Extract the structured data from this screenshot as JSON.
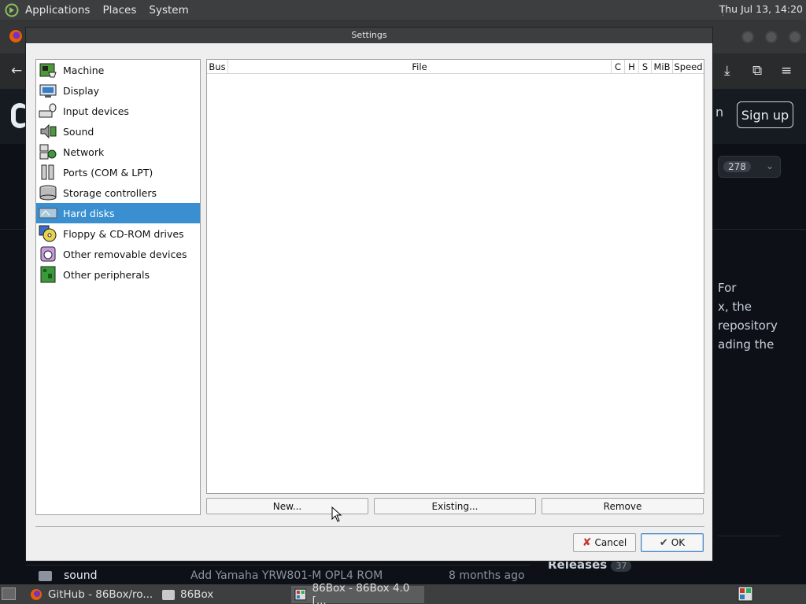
{
  "topbar": {
    "menus": [
      "Applications",
      "Places",
      "System"
    ],
    "clock": "Thu Jul 13, 14:20"
  },
  "background": {
    "signup": "Sign up",
    "in_partial": "n",
    "star_count": "278",
    "text_lines": [
      "For",
      "x, the",
      "repository",
      "ading the"
    ],
    "row_folder": "sound",
    "row_commit": "Add Yamaha YRW801-M OPL4 ROM",
    "row_time": "8 months ago",
    "releases_label": "Releases",
    "releases_count": "37"
  },
  "dialog": {
    "title": "Settings",
    "categories": [
      {
        "label": "Machine",
        "icon": "machine-icon"
      },
      {
        "label": "Display",
        "icon": "display-icon"
      },
      {
        "label": "Input devices",
        "icon": "input-devices-icon"
      },
      {
        "label": "Sound",
        "icon": "sound-icon"
      },
      {
        "label": "Network",
        "icon": "network-icon"
      },
      {
        "label": "Ports (COM & LPT)",
        "icon": "ports-icon"
      },
      {
        "label": "Storage controllers",
        "icon": "storage-icon"
      },
      {
        "label": "Hard disks",
        "icon": "hard-disk-icon",
        "selected": true
      },
      {
        "label": "Floppy & CD-ROM drives",
        "icon": "floppy-cdrom-icon"
      },
      {
        "label": "Other removable devices",
        "icon": "removable-devices-icon"
      },
      {
        "label": "Other peripherals",
        "icon": "peripherals-icon"
      }
    ],
    "columns": [
      "Bus",
      "File",
      "C",
      "H",
      "S",
      "MiB",
      "Speed"
    ],
    "buttons": {
      "new": "New...",
      "existing": "Existing...",
      "remove": "Remove"
    },
    "cancel": "Cancel",
    "ok": "OK"
  },
  "taskbar": {
    "tasks": [
      "GitHub - 86Box/ro...",
      "86Box",
      "86Box - 86Box 4.0 [..."
    ]
  },
  "colors": {
    "selection": "#3a8fd0",
    "panel": "#3c3e40",
    "dialog_bg": "#efefef"
  }
}
